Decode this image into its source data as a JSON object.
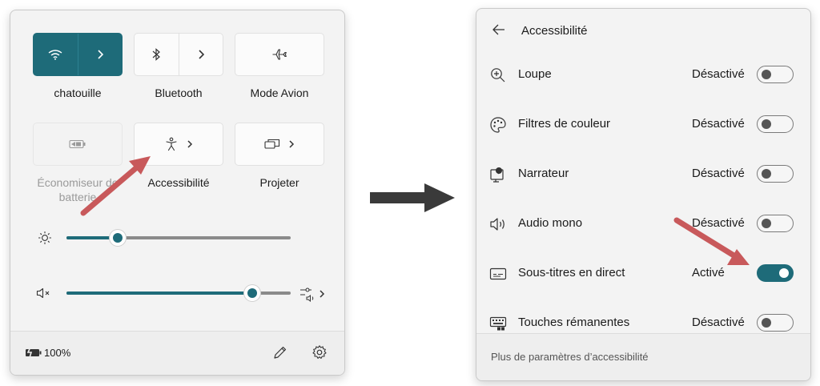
{
  "left_panel": {
    "tiles": [
      {
        "name": "chatouille",
        "label": "chatouille",
        "state": "on",
        "icon": "wifi-icon"
      },
      {
        "name": "bluetooth",
        "label": "Bluetooth",
        "state": "off",
        "icon": "bluetooth-icon"
      },
      {
        "name": "mode-avion",
        "label": "Mode Avion",
        "state": "off",
        "icon": "airplane-icon"
      },
      {
        "name": "economiseur",
        "label": "Économiseur de batterie",
        "state": "disabled",
        "icon": "battery-saver-icon"
      },
      {
        "name": "accessibilite",
        "label": "Accessibilité",
        "state": "off",
        "icon": "accessibility-icon"
      },
      {
        "name": "projeter",
        "label": "Projeter",
        "state": "off",
        "icon": "project-icon"
      }
    ],
    "brightness": {
      "icon": "brightness-icon",
      "value": 0.23
    },
    "volume": {
      "icon": "volume-mute-icon",
      "value": 0.83,
      "output_icon": "audio-output-icon"
    },
    "footer": {
      "battery": "100%",
      "battery_icon": "battery-charging-icon",
      "edit_icon": "pencil-icon",
      "settings_icon": "gear-icon"
    }
  },
  "right_panel": {
    "title": "Accessibilité",
    "back_icon": "back-arrow-icon",
    "rows": [
      {
        "label": "Loupe",
        "state": "Désactivé",
        "on": false,
        "icon": "magnifier-icon"
      },
      {
        "label": "Filtres de couleur",
        "state": "Désactivé",
        "on": false,
        "icon": "palette-icon"
      },
      {
        "label": "Narrateur",
        "state": "Désactivé",
        "on": false,
        "icon": "narrator-icon"
      },
      {
        "label": "Audio mono",
        "state": "Désactivé",
        "on": false,
        "icon": "speaker-icon"
      },
      {
        "label": "Sous-titres en direct",
        "state": "Activé",
        "on": true,
        "icon": "captions-icon"
      },
      {
        "label": "Touches rémanentes",
        "state": "Désactivé",
        "on": false,
        "icon": "sticky-keys-icon"
      }
    ],
    "footer_link": "Plus de paramètres d’accessibilité"
  },
  "colors": {
    "accent": "#1e6b79",
    "annotation_arrow": "#c8595b",
    "transition_arrow": "#3a3a3a"
  }
}
